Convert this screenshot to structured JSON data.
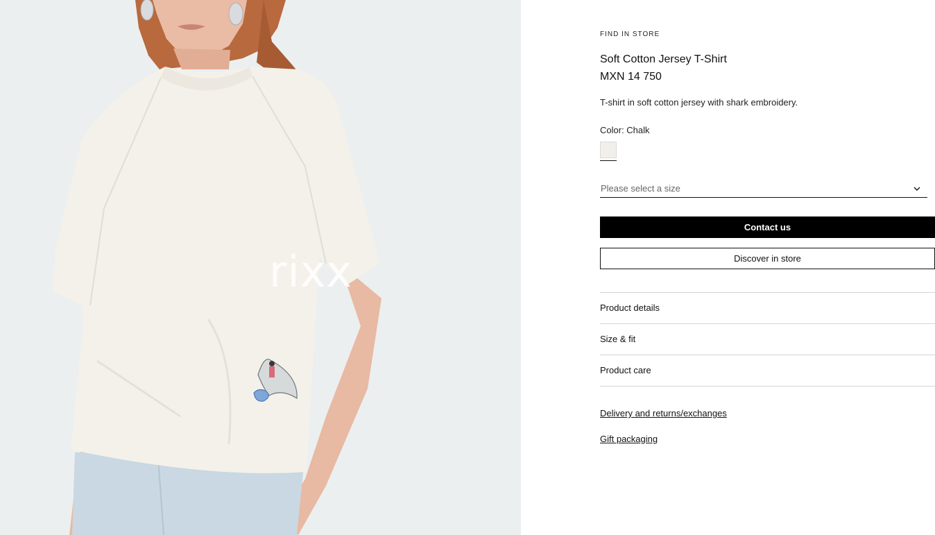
{
  "product_image": {
    "watermark": "rixx",
    "colors": {
      "background": "#eceff0",
      "shirt": "#f4f1ea",
      "skin": "#e9b9a2",
      "hair": "#b8693e",
      "jeans": "#c9d8e2"
    }
  },
  "info": {
    "find_in_store": "FIND IN STORE",
    "title": "Soft Cotton Jersey T-Shirt",
    "price": "MXN 14 750",
    "description": "T-shirt in soft cotton jersey with shark embroidery.",
    "color_label": "Color: Chalk",
    "swatch_color": "#f1efe9",
    "size_placeholder": "Please select a size",
    "contact_button": "Contact us",
    "discover_button": "Discover in store",
    "accordion": [
      {
        "label": "Product details"
      },
      {
        "label": "Size & fit"
      },
      {
        "label": "Product care"
      }
    ],
    "links": {
      "delivery": "Delivery and returns/exchanges",
      "gift": "Gift packaging"
    }
  }
}
